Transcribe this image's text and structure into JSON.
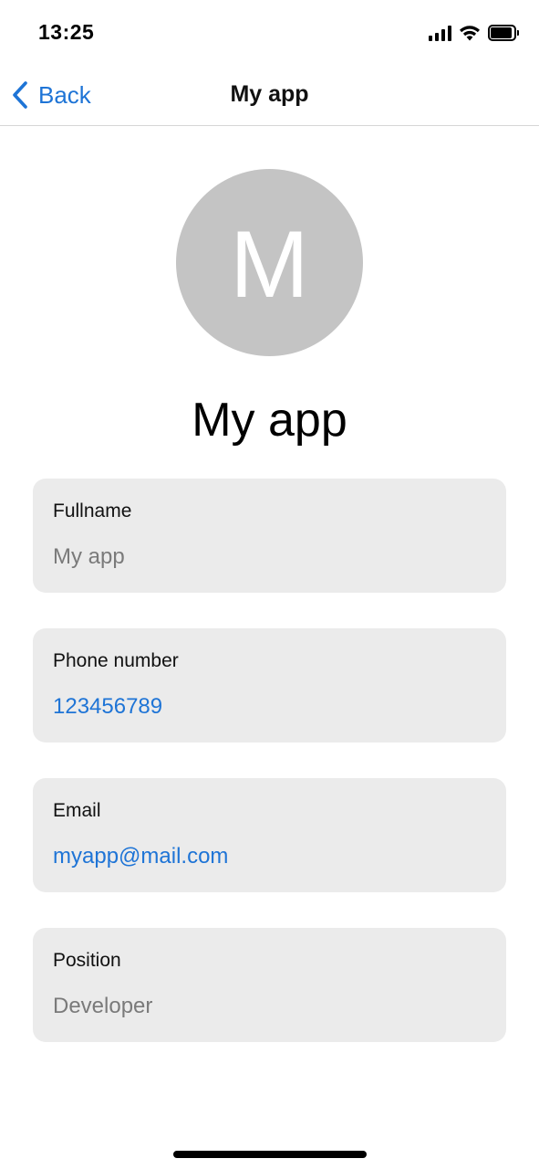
{
  "status_bar": {
    "time": "13:25",
    "icons": [
      "signal-icon",
      "wifi-icon",
      "battery-icon"
    ]
  },
  "nav": {
    "back_label": "Back",
    "back_icon": "chevron-left-icon",
    "title": "My app"
  },
  "profile": {
    "avatar_initial": "M",
    "name": "My app"
  },
  "fields": [
    {
      "label": "Fullname",
      "value": "My app"
    },
    {
      "label": "Phone number",
      "value": "123456789"
    },
    {
      "label": "Email",
      "value": "myapp@mail.com"
    },
    {
      "label": "Position",
      "value": "Developer"
    }
  ],
  "colors": {
    "accent": "#1e74d6",
    "card_background": "#ebebeb",
    "avatar_background": "#c4c4c4",
    "muted_text": "#7a7a7a"
  }
}
